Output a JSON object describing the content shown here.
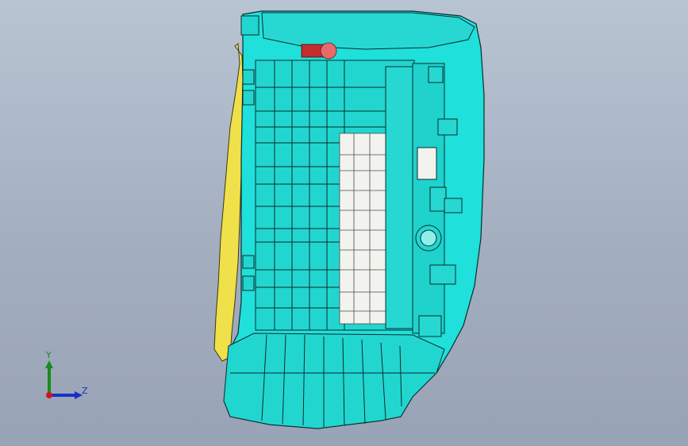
{
  "viewport": {
    "background_top": "#b9c4d3",
    "background_bottom": "#98a3b5"
  },
  "model": {
    "body_color": "#1fe0da",
    "edge_color": "#0b2b2e",
    "cutout_color": "#f2f3ee",
    "trim_color": "#f0e04a",
    "marker_color": "#e86a6a"
  },
  "triad": {
    "y_label": "Y",
    "z_label": "Z",
    "y_color": "#1a8a1a",
    "z_color": "#1a30c8",
    "x_color": "#d01818"
  }
}
